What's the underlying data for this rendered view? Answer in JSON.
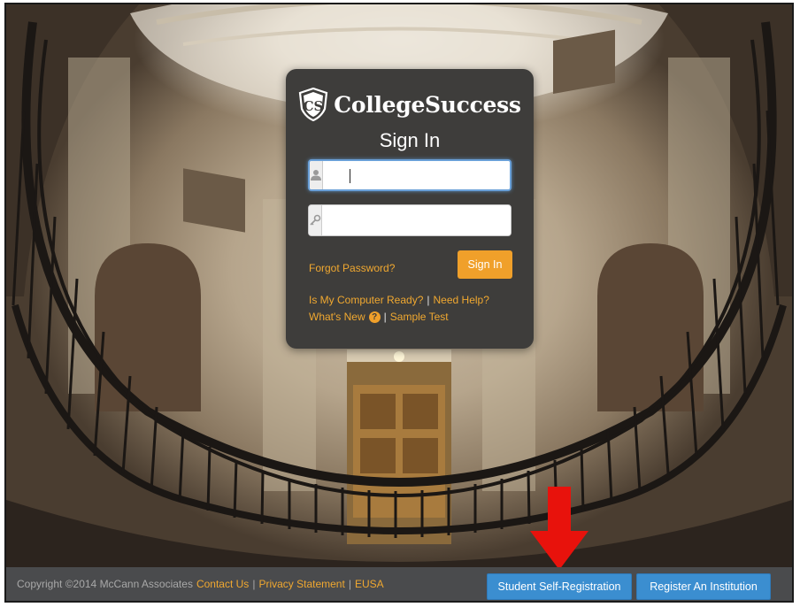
{
  "brand": {
    "logo_mark": "CS",
    "name": "CollegeSuccess"
  },
  "login": {
    "title": "Sign In",
    "username": {
      "value": "",
      "placeholder": "",
      "icon": "user-icon"
    },
    "password": {
      "value": "",
      "placeholder": "",
      "icon": "key-icon"
    },
    "forgot_password": "Forgot Password?",
    "sign_in_button": "Sign In",
    "links": {
      "computer_ready": "Is My Computer Ready?",
      "need_help": "Need Help?",
      "whats_new": "What's New",
      "whats_new_icon": "?",
      "sample_test": "Sample Test",
      "separator": "|"
    }
  },
  "footer": {
    "copyright": "Copyright ©2014 McCann Associates",
    "contact_us": "Contact Us",
    "privacy": "Privacy Statement",
    "eusa": "EUSA",
    "separator": "|",
    "student_registration_button": "Student Self-Registration",
    "register_institution_button": "Register An Institution"
  },
  "colors": {
    "accent_orange": "#f0a02a",
    "button_blue": "#3b8ed0",
    "panel_bg": "#3e3d3b",
    "annotation_arrow": "#e8120c"
  }
}
